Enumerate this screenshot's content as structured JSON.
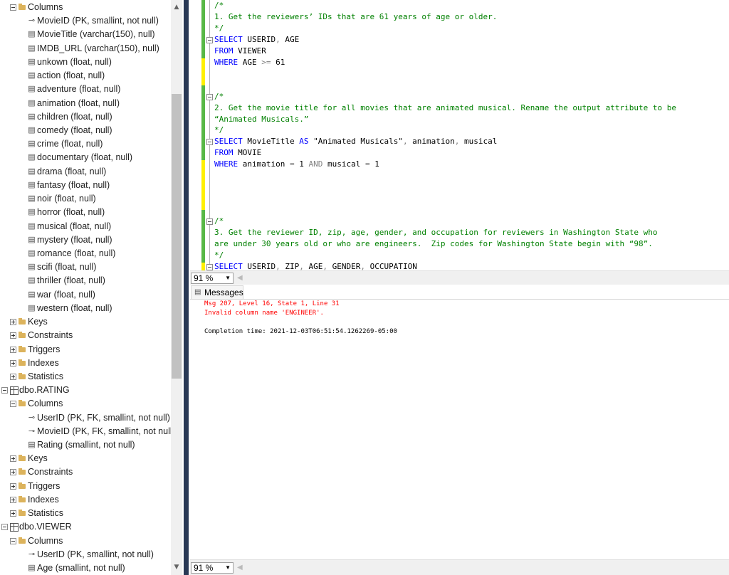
{
  "explorer": {
    "nodes": [
      {
        "label": "Columns",
        "type": "folder",
        "expander": "minus",
        "level": 1
      },
      {
        "label": "MovieID (PK, smallint, not null)",
        "type": "key",
        "level": 2
      },
      {
        "label": "MovieTitle (varchar(150), null)",
        "type": "column",
        "level": 2
      },
      {
        "label": "IMDB_URL (varchar(150), null)",
        "type": "column",
        "level": 2
      },
      {
        "label": "unkown (float, null)",
        "type": "column",
        "level": 2
      },
      {
        "label": "action (float, null)",
        "type": "column",
        "level": 2
      },
      {
        "label": "adventure (float, null)",
        "type": "column",
        "level": 2
      },
      {
        "label": "animation (float, null)",
        "type": "column",
        "level": 2
      },
      {
        "label": "children (float, null)",
        "type": "column",
        "level": 2
      },
      {
        "label": "comedy (float, null)",
        "type": "column",
        "level": 2
      },
      {
        "label": "crime (float, null)",
        "type": "column",
        "level": 2
      },
      {
        "label": "documentary (float, null)",
        "type": "column",
        "level": 2
      },
      {
        "label": "drama (float, null)",
        "type": "column",
        "level": 2
      },
      {
        "label": "fantasy (float, null)",
        "type": "column",
        "level": 2
      },
      {
        "label": "noir (float, null)",
        "type": "column",
        "level": 2
      },
      {
        "label": "horror (float, null)",
        "type": "column",
        "level": 2
      },
      {
        "label": "musical (float, null)",
        "type": "column",
        "level": 2
      },
      {
        "label": "mystery (float, null)",
        "type": "column",
        "level": 2
      },
      {
        "label": "romance (float, null)",
        "type": "column",
        "level": 2
      },
      {
        "label": "scifi (float, null)",
        "type": "column",
        "level": 2
      },
      {
        "label": "thriller (float, null)",
        "type": "column",
        "level": 2
      },
      {
        "label": "war (float, null)",
        "type": "column",
        "level": 2
      },
      {
        "label": "western (float, null)",
        "type": "column",
        "level": 2
      },
      {
        "label": "Keys",
        "type": "folder",
        "expander": "plus",
        "level": 1
      },
      {
        "label": "Constraints",
        "type": "folder",
        "expander": "plus",
        "level": 1
      },
      {
        "label": "Triggers",
        "type": "folder",
        "expander": "plus",
        "level": 1
      },
      {
        "label": "Indexes",
        "type": "folder",
        "expander": "plus",
        "level": 1
      },
      {
        "label": "Statistics",
        "type": "folder",
        "expander": "plus",
        "level": 1
      },
      {
        "label": "dbo.RATING",
        "type": "table",
        "expander": "minus",
        "level": 0
      },
      {
        "label": "Columns",
        "type": "folder",
        "expander": "minus",
        "level": 1
      },
      {
        "label": "UserID (PK, FK, smallint, not null)",
        "type": "key",
        "level": 2
      },
      {
        "label": "MovieID (PK, FK, smallint, not null)",
        "type": "key",
        "level": 2
      },
      {
        "label": "Rating (smallint, not null)",
        "type": "column",
        "level": 2
      },
      {
        "label": "Keys",
        "type": "folder",
        "expander": "plus",
        "level": 1
      },
      {
        "label": "Constraints",
        "type": "folder",
        "expander": "plus",
        "level": 1
      },
      {
        "label": "Triggers",
        "type": "folder",
        "expander": "plus",
        "level": 1
      },
      {
        "label": "Indexes",
        "type": "folder",
        "expander": "plus",
        "level": 1
      },
      {
        "label": "Statistics",
        "type": "folder",
        "expander": "plus",
        "level": 1
      },
      {
        "label": "dbo.VIEWER",
        "type": "table",
        "expander": "minus",
        "level": 0
      },
      {
        "label": "Columns",
        "type": "folder",
        "expander": "minus",
        "level": 1
      },
      {
        "label": "UserID (PK, smallint, not null)",
        "type": "key",
        "level": 2
      },
      {
        "label": "Age (smallint, not null)",
        "type": "column",
        "level": 2
      }
    ]
  },
  "editor": {
    "lines": [
      {
        "fold": false,
        "tokens": [
          [
            "c",
            "/*"
          ]
        ]
      },
      {
        "fold": false,
        "tokens": [
          [
            "c",
            "1. Get the reviewers’ IDs that are 61 years of age or older."
          ]
        ]
      },
      {
        "fold": false,
        "tokens": [
          [
            "c",
            "*/"
          ]
        ]
      },
      {
        "fold": true,
        "tokens": [
          [
            "k",
            "SELECT"
          ],
          [
            "t",
            " USERID"
          ],
          [
            "o",
            ","
          ],
          [
            "t",
            " AGE"
          ]
        ]
      },
      {
        "fold": false,
        "tokens": [
          [
            "k",
            "FROM"
          ],
          [
            "t",
            " VIEWER"
          ]
        ]
      },
      {
        "fold": false,
        "tokens": [
          [
            "k",
            "WHERE"
          ],
          [
            "t",
            " AGE "
          ],
          [
            "o",
            ">="
          ],
          [
            "t",
            " 61"
          ]
        ]
      },
      {
        "fold": false,
        "tokens": []
      },
      {
        "fold": false,
        "tokens": []
      },
      {
        "fold": true,
        "tokens": [
          [
            "c",
            "/*"
          ]
        ]
      },
      {
        "fold": false,
        "tokens": [
          [
            "c",
            "2. Get the movie title for all movies that are animated musical. Rename the output attribute to be"
          ]
        ]
      },
      {
        "fold": false,
        "tokens": [
          [
            "c",
            "“Animated Musicals.”"
          ]
        ]
      },
      {
        "fold": false,
        "tokens": [
          [
            "c",
            "*/"
          ]
        ]
      },
      {
        "fold": true,
        "tokens": [
          [
            "k",
            "SELECT"
          ],
          [
            "t",
            " MovieTitle "
          ],
          [
            "k",
            "AS"
          ],
          [
            "t",
            " \"Animated Musicals\""
          ],
          [
            "o",
            ","
          ],
          [
            "t",
            " animation"
          ],
          [
            "o",
            ","
          ],
          [
            "t",
            " musical"
          ]
        ]
      },
      {
        "fold": false,
        "tokens": [
          [
            "k",
            "FROM"
          ],
          [
            "t",
            " MOVIE"
          ]
        ]
      },
      {
        "fold": false,
        "tokens": [
          [
            "k",
            "WHERE"
          ],
          [
            "t",
            " animation "
          ],
          [
            "o",
            "="
          ],
          [
            "t",
            " 1 "
          ],
          [
            "o",
            "AND"
          ],
          [
            "t",
            " musical "
          ],
          [
            "o",
            "="
          ],
          [
            "t",
            " 1"
          ]
        ]
      },
      {
        "fold": false,
        "tokens": []
      },
      {
        "fold": false,
        "tokens": []
      },
      {
        "fold": false,
        "tokens": []
      },
      {
        "fold": false,
        "tokens": []
      },
      {
        "fold": true,
        "tokens": [
          [
            "c",
            "/*"
          ]
        ]
      },
      {
        "fold": false,
        "tokens": [
          [
            "c",
            "3. Get the reviewer ID, zip, age, gender, and occupation for reviewers in Washington State who"
          ]
        ]
      },
      {
        "fold": false,
        "tokens": [
          [
            "c",
            "are under 30 years old or who are engineers.  Zip codes for Washington State begin with “98”."
          ]
        ]
      },
      {
        "fold": false,
        "tokens": [
          [
            "c",
            "*/"
          ]
        ]
      },
      {
        "fold": true,
        "tokens": [
          [
            "k",
            "SELECT"
          ],
          [
            "t",
            " USERID"
          ],
          [
            "o",
            ","
          ],
          [
            "t",
            " ZIP"
          ],
          [
            "o",
            ","
          ],
          [
            "t",
            " AGE"
          ],
          [
            "o",
            ","
          ],
          [
            "t",
            " GENDER"
          ],
          [
            "o",
            ","
          ],
          [
            "t",
            " OCCUPATION"
          ]
        ]
      }
    ]
  },
  "zoom_top": "91 %",
  "zoom_bottom": "91 %",
  "results": {
    "tab_label": "Messages",
    "error_line1": "Msg 207, Level 16, State 1, Line 31",
    "error_line2": "Invalid column name 'ENGINEER'.",
    "completion": "Completion time: 2021-12-03T06:51:54.1262269-05:00"
  }
}
